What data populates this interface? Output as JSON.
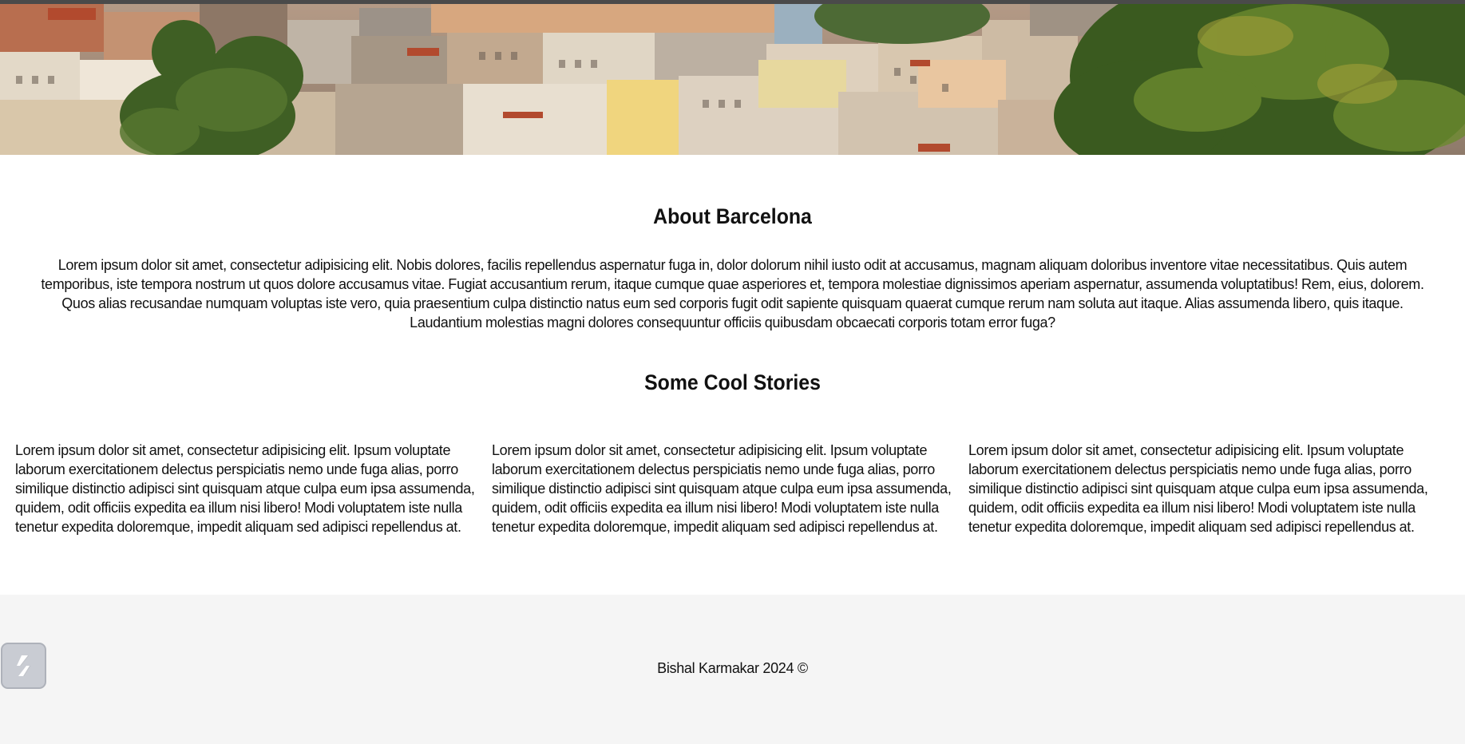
{
  "hero": {
    "image_alt": "Barcelona cityscape"
  },
  "about": {
    "title": "About Barcelona",
    "text": "Lorem ipsum dolor sit amet, consectetur adipisicing elit. Nobis dolores, facilis repellendus aspernatur fuga in, dolor dolorum nihil iusto odit at accusamus, magnam aliquam doloribus inventore vitae necessitatibus. Quis autem temporibus, iste tempora nostrum ut quos dolore accusamus vitae. Fugiat accusantium rerum, itaque cumque quae asperiores et, tempora molestiae dignissimos aperiam aspernatur, assumenda voluptatibus! Rem, eius, dolorem. Quos alias recusandae numquam voluptas iste vero, quia praesentium culpa distinctio natus eum sed corporis fugit odit sapiente quisquam quaerat cumque rerum nam soluta aut itaque. Alias assumenda libero, quis itaque. Laudantium molestias magni dolores consequuntur officiis quibusdam obcaecati corporis totam error fuga?"
  },
  "stories": {
    "title": "Some Cool Stories",
    "items": [
      {
        "text": "Lorem ipsum dolor sit amet, consectetur adipisicing elit. Ipsum voluptate laborum exercitationem delectus perspiciatis nemo unde fuga alias, porro similique distinctio adipisci sint quisquam atque culpa eum ipsa assumenda, quidem, odit officiis expedita ea illum nisi libero! Modi voluptatem iste nulla tenetur expedita doloremque, impedit aliquam sed adipisci repellendus at."
      },
      {
        "text": "Lorem ipsum dolor sit amet, consectetur adipisicing elit. Ipsum voluptate laborum exercitationem delectus perspiciatis nemo unde fuga alias, porro similique distinctio adipisci sint quisquam atque culpa eum ipsa assumenda, quidem, odit officiis expedita ea illum nisi libero! Modi voluptatem iste nulla tenetur expedita doloremque, impedit aliquam sed adipisci repellendus at."
      },
      {
        "text": "Lorem ipsum dolor sit amet, consectetur adipisicing elit. Ipsum voluptate laborum exercitationem delectus perspiciatis nemo unde fuga alias, porro similique distinctio adipisci sint quisquam atque culpa eum ipsa assumenda, quidem, odit officiis expedita ea illum nisi libero! Modi voluptatem iste nulla tenetur expedita doloremque, impedit aliquam sed adipisci repellendus at."
      }
    ]
  },
  "footer": {
    "text": "Bishal Karmakar 2024 ©"
  },
  "float_button": {
    "icon": "lightning-bolt-icon"
  },
  "colors": {
    "footer_bg": "#f5f5f5",
    "text": "#111111",
    "topbar": "#4a4a4a"
  }
}
